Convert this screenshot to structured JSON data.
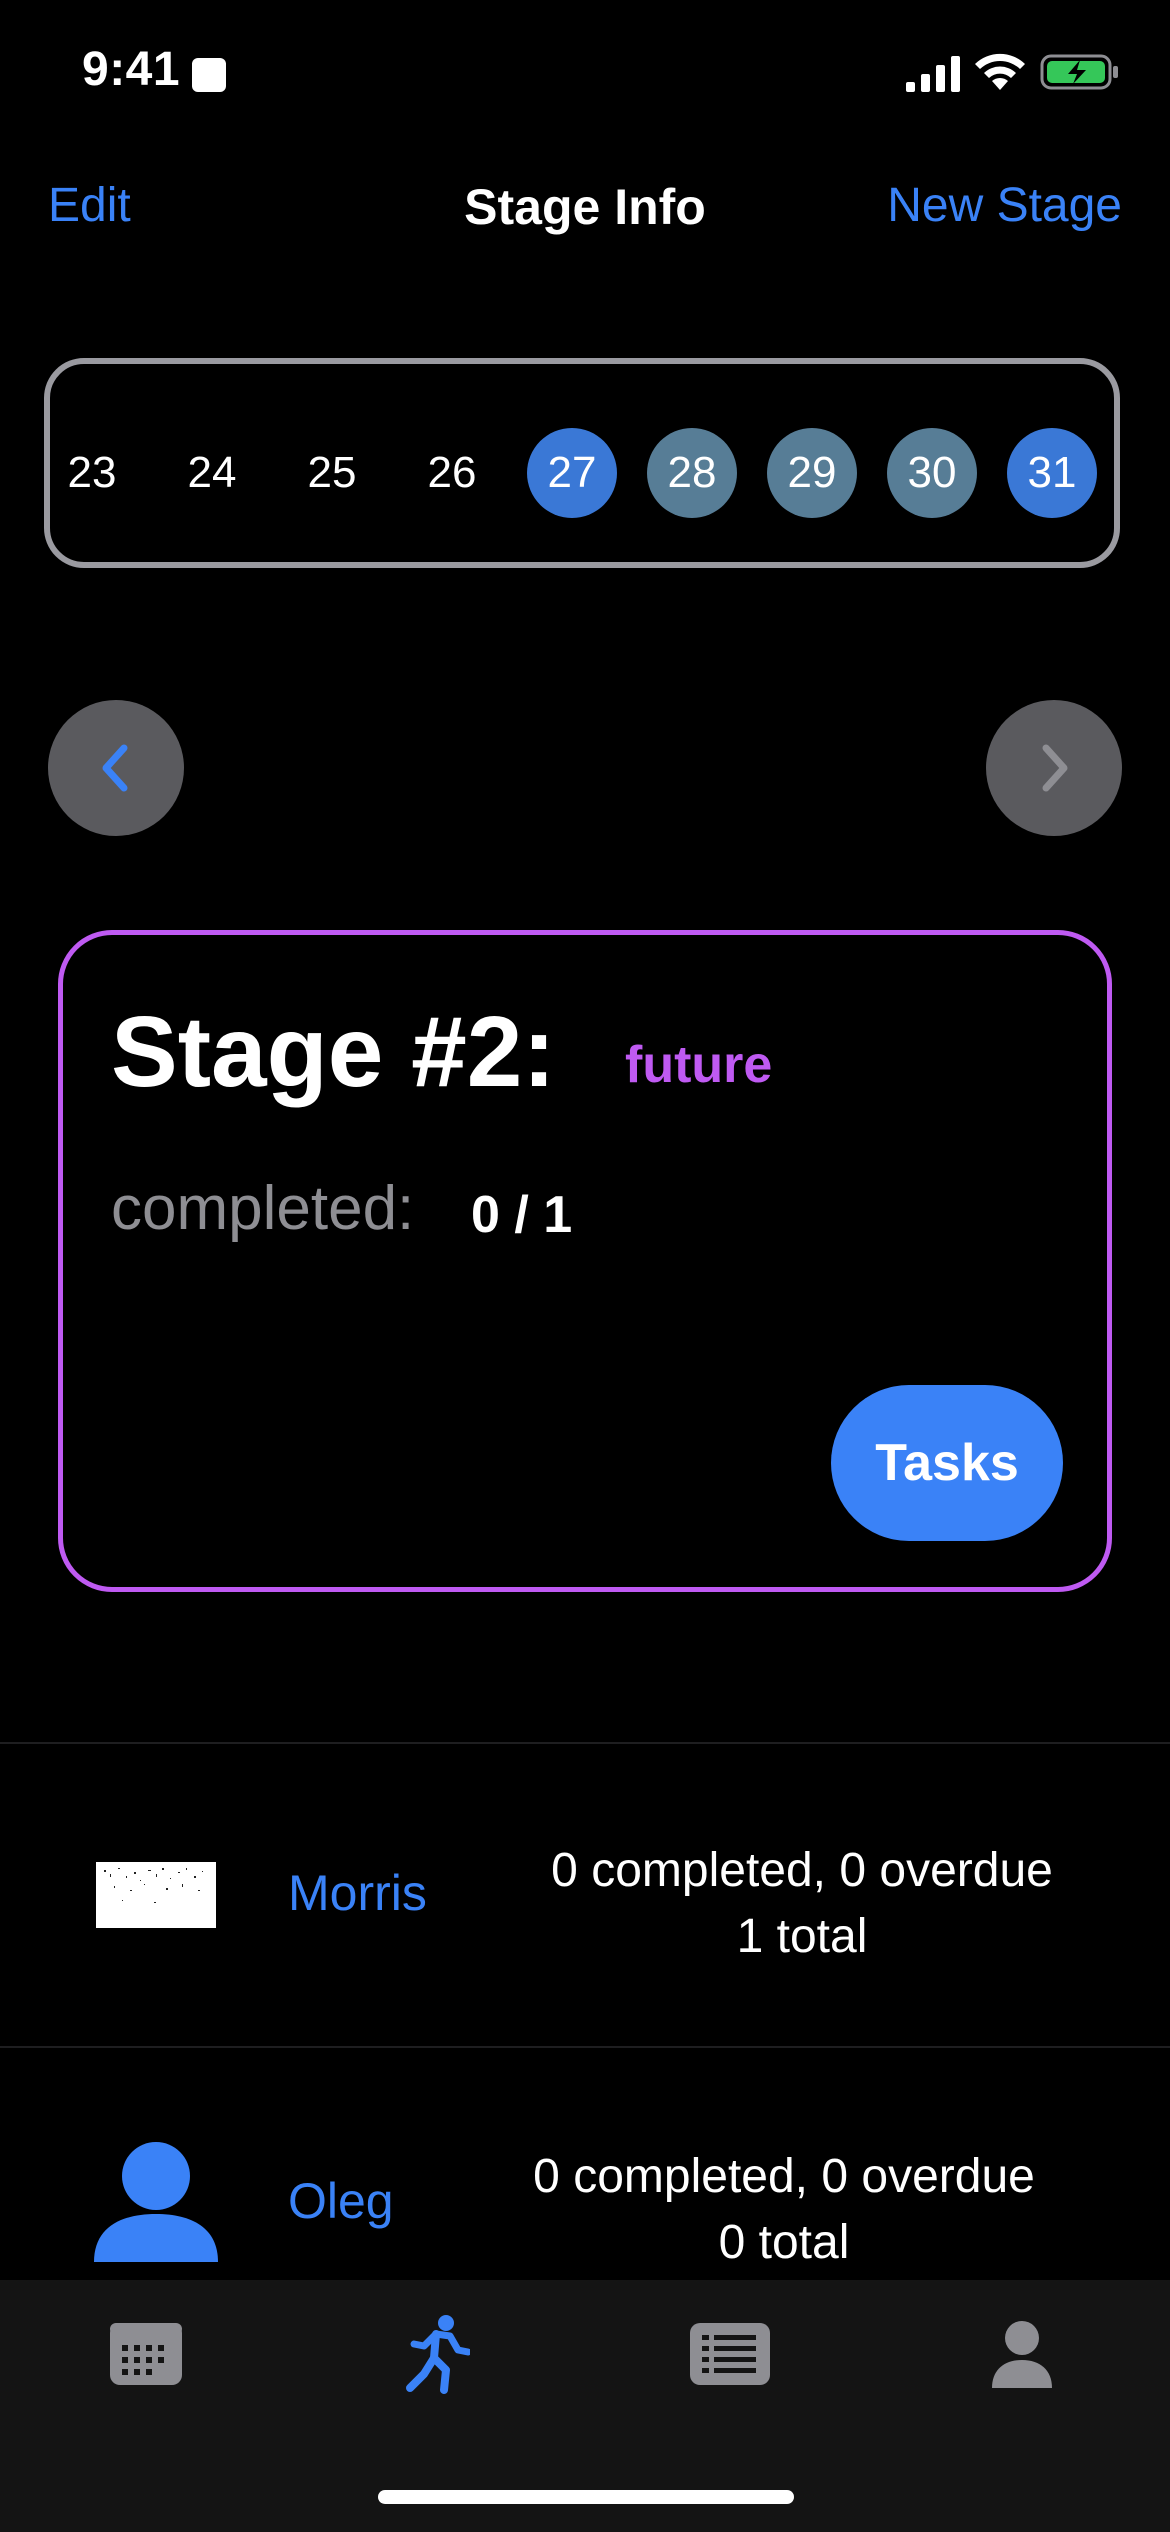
{
  "status_bar": {
    "time": "9:41"
  },
  "nav": {
    "edit_label": "Edit",
    "title": "Stage Info",
    "new_stage_label": "New Stage"
  },
  "days": [
    {
      "label": "23",
      "state": "none"
    },
    {
      "label": "24",
      "state": "none"
    },
    {
      "label": "25",
      "state": "none"
    },
    {
      "label": "26",
      "state": "none"
    },
    {
      "label": "27",
      "state": "selected-blue"
    },
    {
      "label": "28",
      "state": "selected-grey"
    },
    {
      "label": "29",
      "state": "selected-grey"
    },
    {
      "label": "30",
      "state": "selected-grey"
    },
    {
      "label": "31",
      "state": "selected-blue"
    }
  ],
  "stage": {
    "title": "Stage #2:",
    "status": "future",
    "completed_label": "completed:",
    "completed_value": "0 / 1",
    "tasks_label": "Tasks"
  },
  "members": [
    {
      "name": "Morris",
      "stats_line1": "0 completed, 0 overdue",
      "stats_line2": "1 total",
      "avatar": "photo"
    },
    {
      "name": "Oleg",
      "stats_line1": "0 completed, 0 overdue",
      "stats_line2": "0 total",
      "avatar": "person-icon"
    }
  ],
  "tab_bar": {
    "tabs": [
      {
        "icon": "calendar-icon",
        "active": false
      },
      {
        "icon": "running-figure-icon",
        "active": true
      },
      {
        "icon": "list-icon",
        "active": false
      },
      {
        "icon": "person-icon",
        "active": false
      }
    ]
  },
  "colors": {
    "accent": "#3a82f7",
    "stage_purple": "#bf5af2",
    "day_blue": "#3a78d6",
    "day_grey": "#577d96"
  }
}
